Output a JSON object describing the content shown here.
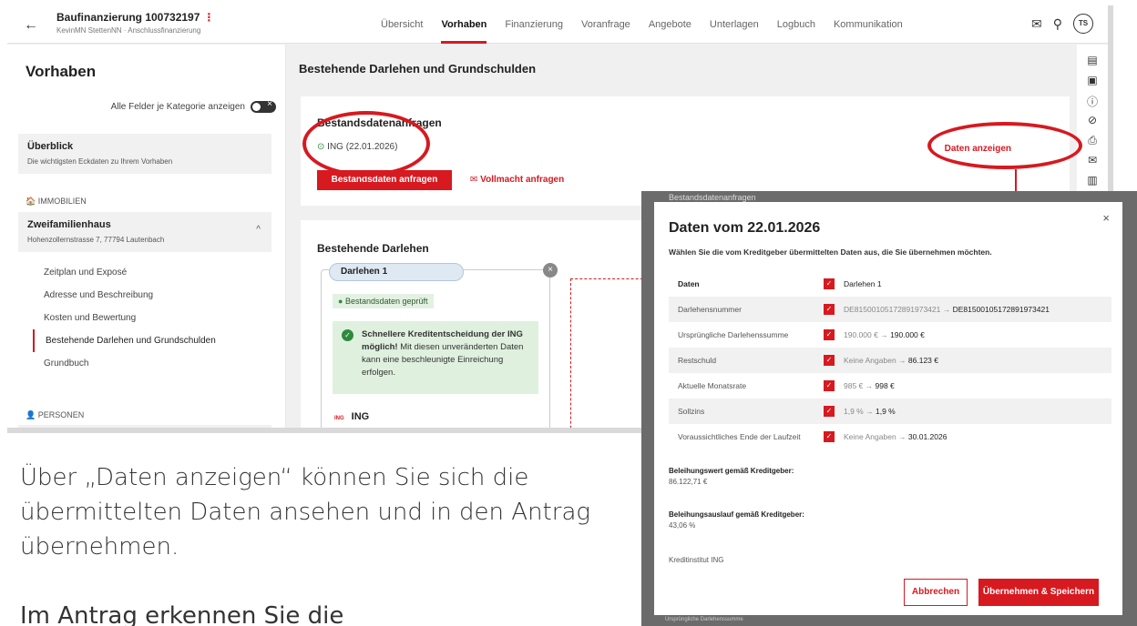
{
  "header": {
    "title": "Baufinanzierung 100732197",
    "subtitle": "KevinMN StettenNN · Anschlussfinanzierung",
    "nav": [
      "Übersicht",
      "Vorhaben",
      "Finanzierung",
      "Voranfrage",
      "Angebote",
      "Unterlagen",
      "Logbuch",
      "Kommunikation"
    ],
    "active_nav": "Vorhaben",
    "avatar": "TS"
  },
  "sidebar": {
    "title": "Vorhaben",
    "toggle_label": "Alle Felder je Kategorie anzeigen",
    "overview_title": "Überblick",
    "overview_sub": "Die wichtigsten Eckdaten zu Ihrem Vorhaben",
    "section_immobilien": "IMMOBILIEN",
    "property_title": "Zweifamilienhaus",
    "property_address": "Hohenzollernstrasse 7, 77794 Lautenbach",
    "items": [
      "Zeitplan und Exposé",
      "Adresse und Beschreibung",
      "Kosten und Bewertung",
      "Bestehende Darlehen und Grundschulden",
      "Grundbuch"
    ],
    "section_personen": "PERSONEN"
  },
  "main": {
    "heading": "Bestehende Darlehen und Grundschulden",
    "bestandsdaten_heading": "Bestandsdatenanfragen",
    "ing_entry": "ING (22.01.2026)",
    "btn_anfragen": "Bestandsdaten anfragen",
    "btn_vollmacht": "Vollmacht anfragen",
    "btn_daten": "Daten anzeigen",
    "darlehen_heading": "Bestehende Darlehen",
    "loan_tab": "Darlehen 1",
    "badge": "Bestandsdaten geprüft",
    "green_bold": "Schnellere Kreditentscheidung der ING möglich!",
    "green_text": " Mit diesen unveränderten Daten kann eine beschleunigte Einreichung erfolgen.",
    "ing_label": "ING",
    "ing_logo_text": "ING"
  },
  "modal": {
    "overlay_text": "Bestandsdatenanfragen",
    "title": "Daten vom 22.01.2026",
    "intro": "Wählen Sie die vom Kreditgeber übermittelten Daten aus, die Sie übernehmen möchten.",
    "header_label": "Daten",
    "header_value": "Darlehen 1",
    "rows": [
      {
        "label": "Darlehensnummer",
        "old": "DE81500105172891973421",
        "new": "DE81500105172891973421"
      },
      {
        "label": "Ursprüngliche Darlehenssumme",
        "old": "190.000 €",
        "new": "190.000 €"
      },
      {
        "label": "Restschuld",
        "old": "Keine Angaben",
        "new": "86.123 €"
      },
      {
        "label": "Aktuelle Monatsrate",
        "old": "985 €",
        "new": "998 €"
      },
      {
        "label": "Sollzins",
        "old": "1,9 %",
        "new": "1,9 %"
      },
      {
        "label": "Voraussichtliches Ende der Laufzeit",
        "old": "Keine Angaben",
        "new": "30.01.2026"
      }
    ],
    "beleihungswert_label": "Beleihungswert gemäß Kreditgeber:",
    "beleihungswert_value": "86.122,71 €",
    "beleihungsauslauf_label": "Beleihungsauslauf gemäß Kreditgeber:",
    "beleihungsauslauf_value": "43,06 %",
    "kreditinstitut": "Kreditinstitut ING",
    "btn_cancel": "Abbrechen",
    "btn_save": "Übernehmen & Speichern",
    "bottom_text": "Ursprüngliche Darlehenssumme"
  },
  "caption": {
    "line1": "Über „Daten anzeigen“ können Sie sich die übermittelten Daten ansehen und in den Antrag übernehmen.",
    "line2": "Im Antrag erkennen Sie die"
  },
  "colors": {
    "accent": "#d71920",
    "success": "#2e8b3e"
  }
}
